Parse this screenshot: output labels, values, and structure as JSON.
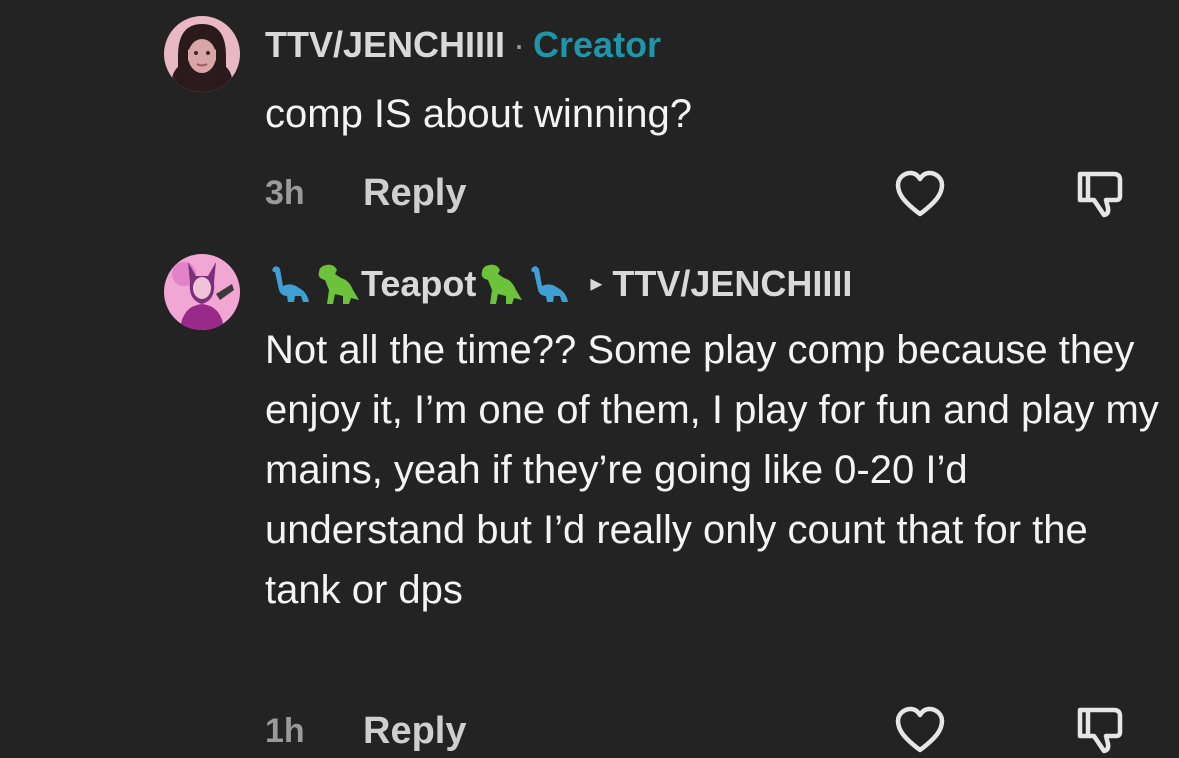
{
  "comments": [
    {
      "username": "TTV/JENCHIIII",
      "separator": "·",
      "badge": "Creator",
      "text": "comp IS about winning?",
      "time": "3h",
      "reply_label": "Reply"
    },
    {
      "username": "Teapot",
      "reply_to": "TTV/JENCHIIII",
      "text": "Not all the time?? Some play comp because they enjoy it, I’m one of them, I play for fun and play my mains, yeah if they’re going like 0-20 I’d understand but I’d really only count that for the tank or dps",
      "time": "1h",
      "reply_label": "Reply"
    }
  ],
  "icons": {
    "like": "heart-outline-icon",
    "dislike": "thumbs-down-outline-icon",
    "reply_arrow": "triangle-right-icon",
    "dino": "dinosaur-emoji"
  },
  "colors": {
    "background": "#232323",
    "creator_badge": "#1e95a8"
  }
}
